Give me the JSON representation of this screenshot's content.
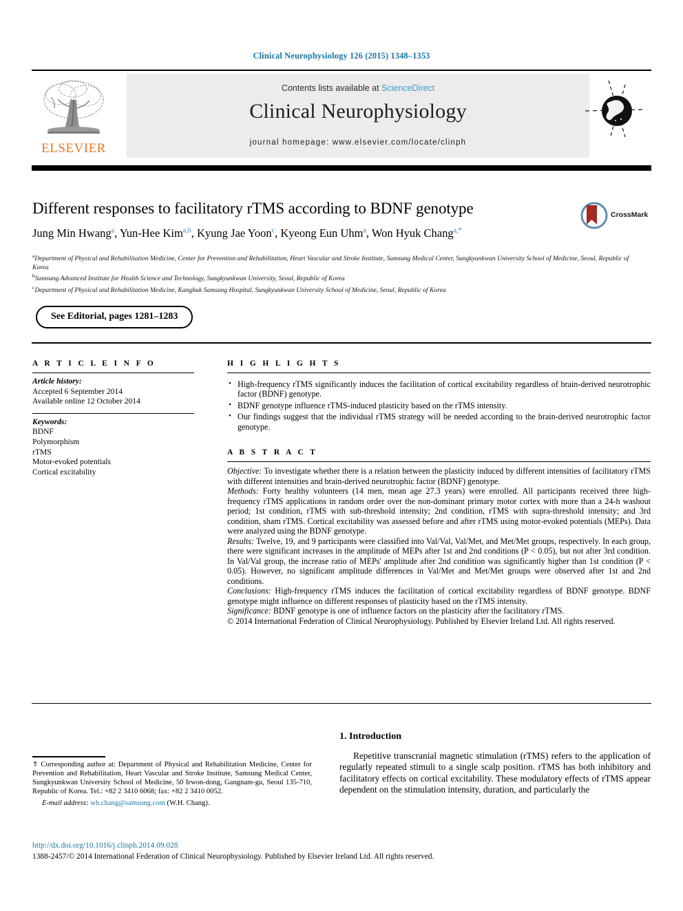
{
  "running_head": "Clinical Neurophysiology 126 (2015) 1348–1353",
  "masthead": {
    "contents_prefix": "Contents lists available at ",
    "sciencedirect": "ScienceDirect",
    "journal_name": "Clinical Neurophysiology",
    "homepage": "journal homepage: www.elsevier.com/locate/clinph",
    "publisher_wordmark": "ELSEVIER",
    "publisher_color": "#e87722",
    "link_color": "#3a9ec9",
    "band_color": "#ececec"
  },
  "article": {
    "title": "Different responses to facilitatory rTMS according to BDNF genotype",
    "authors": [
      {
        "name": "Jung Min Hwang",
        "sup": "a",
        "sep": ", "
      },
      {
        "name": "Yun-Hee Kim",
        "sup": "a,b",
        "sep": ", "
      },
      {
        "name": "Kyung Jae Yoon",
        "sup": "c",
        "sep": ", "
      },
      {
        "name": "Kyeong Eun Uhm",
        "sup": "a",
        "sep": ", "
      },
      {
        "name": "Won Hyuk Chang",
        "sup": "a,*",
        "sep": ""
      }
    ],
    "affiliations": [
      {
        "mark": "a",
        "text": "Department of Physical and Rehabilitation Medicine, Center for Prevention and Rehabilitation, Heart Vascular and Stroke Institute, Samsung Medical Center, Sungkyunkwan University School of Medicine, Seoul, Republic of Korea"
      },
      {
        "mark": "b",
        "text": "Samsung Advanced Institute for Health Science and Technology, Sungkyunkwan University, Seoul, Republic of Korea"
      },
      {
        "mark": "c",
        "text": "Department of Physical and Rehabilitation Medicine, Kangbuk Samsung Hospital, Sungkyunkwan University School of Medicine, Seoul, Republic of Korea"
      }
    ],
    "editorial_note": "See Editorial, pages 1281–1283",
    "crossmark_label": "CrossMark"
  },
  "article_info": {
    "heading": "A R T I C L E   I N F O",
    "history_label": "Article history:",
    "history": [
      "Accepted 6 September 2014",
      "Available online 12 October 2014"
    ],
    "keywords_label": "Keywords:",
    "keywords": [
      "BDNF",
      "Polymorphism",
      "rTMS",
      "Motor-evoked potentials",
      "Cortical excitability"
    ]
  },
  "highlights": {
    "heading": "H I G H L I G H T S",
    "items": [
      "High-frequency rTMS significantly induces the facilitation of cortical excitability regardless of brain-derived neurotrophic factor (BDNF) genotype.",
      "BDNF genotype influence rTMS-induced plasticity based on the rTMS intensity.",
      "Our findings suggest that the individual rTMS strategy will be needed according to the brain-derived neurotrophic factor genotype."
    ]
  },
  "abstract": {
    "heading": "A B S T R A C T",
    "objective_label": "Objective:",
    "objective": " To investigate whether there is a relation between the plasticity induced by different intensities of facilitatory rTMS with different intensities and brain-derived neurotrophic factor (BDNF) genotype.",
    "methods_label": "Methods:",
    "methods": " Forty healthy volunteers (14 men, mean age 27.3 years) were enrolled. All participants received three high-frequency rTMS applications in random order over the non-dominant primary motor cortex with more than a 24-h washout period; 1st condition, rTMS with sub-threshold intensity; 2nd condition, rTMS with supra-threshold intensity; and 3rd condition, sham rTMS. Cortical excitability was assessed before and after rTMS using motor-evoked potentials (MEPs). Data were analyzed using the BDNF genotype.",
    "results_label": "Results:",
    "results": " Twelve, 19, and 9 participants were classified into Val/Val, Val/Met, and Met/Met groups, respectively. In each group, there were significant increases in the amplitude of MEPs after 1st and 2nd conditions (P < 0.05), but not after 3rd condition. In Val/Val group, the increase ratio of MEPs' amplitude after 2nd condition was significantly higher than 1st condition (P < 0.05). However, no significant amplitude differences in Val/Met and Met/Met groups were observed after 1st and 2nd conditions.",
    "conclusions_label": "Conclusions:",
    "conclusions": " High-frequency rTMS induces the facilitation of cortical excitability regardless of BDNF genotype. BDNF genotype might influence on different responses of plasticity based on the rTMS intensity.",
    "significance_label": "Significance:",
    "significance": " BDNF genotype is one of influence factors on the plasticity after the facilitatory rTMS.",
    "copyright": "© 2014 International Federation of Clinical Neurophysiology. Published by Elsevier Ireland Ltd. All rights reserved."
  },
  "introduction": {
    "heading": "1. Introduction",
    "paragraph": "Repetitive transcranial magnetic stimulation (rTMS) refers to the application of regularly repeated stimuli to a single scalp position. rTMS has both inhibitory and facilitatory effects on cortical excitability. These modulatory effects of rTMS appear dependent on the stimulation intensity, duration, and particularly the"
  },
  "footnote": {
    "star": "⇑",
    "corresponding": " Corresponding author at: Department of Physical and Rehabilitation Medicine, Center for Prevention and Rehabilitation, Heart Vascular and Stroke Institute, Samsung Medical Center, Sungkyunkwan University School of Medicine, 50 Irwon-dong, Gangnam-gu, Seoul 135-710, Republic of Korea. Tel.: +82 2 3410 6068; fax: +82 2 3410 0052.",
    "email_label": "E-mail address:",
    "email": "wh.chang@samsung.com",
    "email_owner": " (W.H. Chang)."
  },
  "bottom": {
    "doi": "http://dx.doi.org/10.1016/j.clinph.2014.09.028",
    "issn_line": "1388-2457/© 2014 International Federation of Clinical Neurophysiology. Published by Elsevier Ireland Ltd. All rights reserved."
  }
}
